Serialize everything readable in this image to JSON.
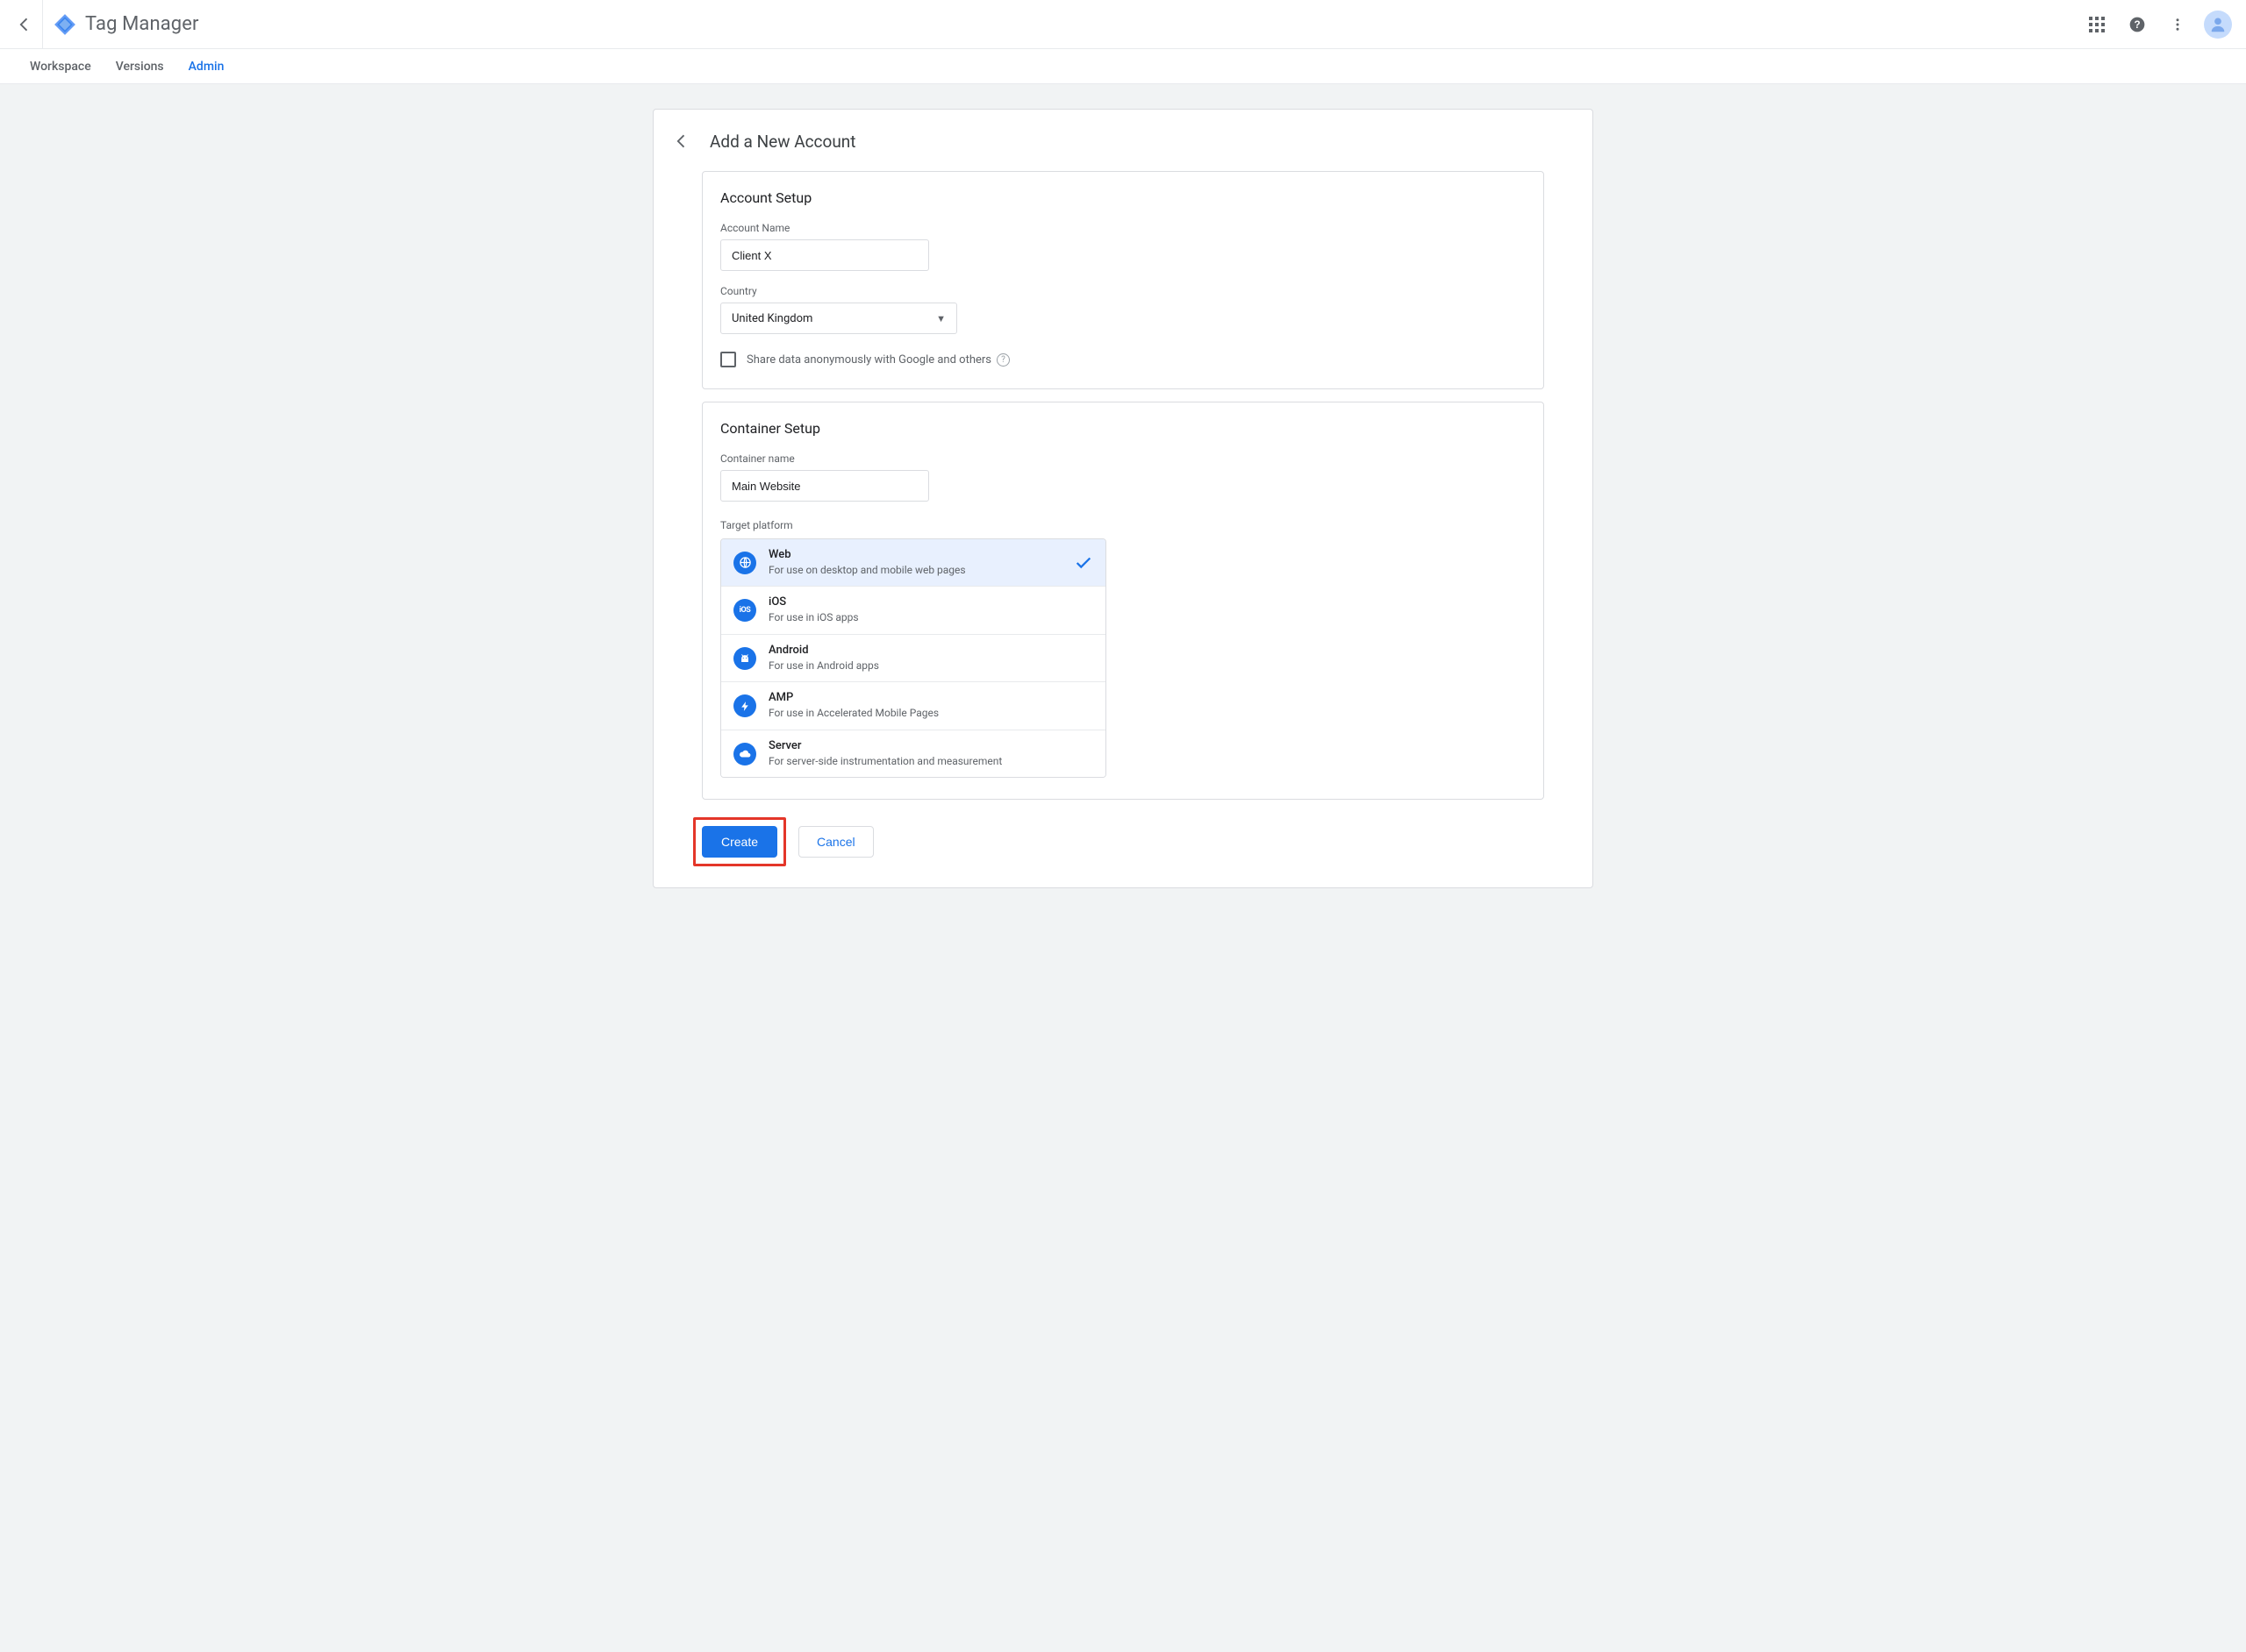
{
  "header": {
    "app_title": "Tag Manager"
  },
  "tabs": {
    "items": [
      {
        "label": "Workspace"
      },
      {
        "label": "Versions"
      },
      {
        "label": "Admin"
      }
    ],
    "active_index": 2
  },
  "page": {
    "title": "Add a New Account"
  },
  "account": {
    "section_title": "Account Setup",
    "name_label": "Account Name",
    "name_value": "Client X",
    "country_label": "Country",
    "country_value": "United Kingdom",
    "share_label": "Share data anonymously with Google and others"
  },
  "container": {
    "section_title": "Container Setup",
    "name_label": "Container name",
    "name_value": "Main Website",
    "target_label": "Target platform",
    "platforms": [
      {
        "name": "Web",
        "desc": "For use on desktop and mobile web pages",
        "selected": true,
        "icon": "globe"
      },
      {
        "name": "iOS",
        "desc": "For use in iOS apps",
        "selected": false,
        "icon": "ios"
      },
      {
        "name": "Android",
        "desc": "For use in Android apps",
        "selected": false,
        "icon": "android"
      },
      {
        "name": "AMP",
        "desc": "For use in Accelerated Mobile Pages",
        "selected": false,
        "icon": "amp"
      },
      {
        "name": "Server",
        "desc": "For server-side instrumentation and measurement",
        "selected": false,
        "icon": "server"
      }
    ]
  },
  "actions": {
    "create": "Create",
    "cancel": "Cancel"
  }
}
